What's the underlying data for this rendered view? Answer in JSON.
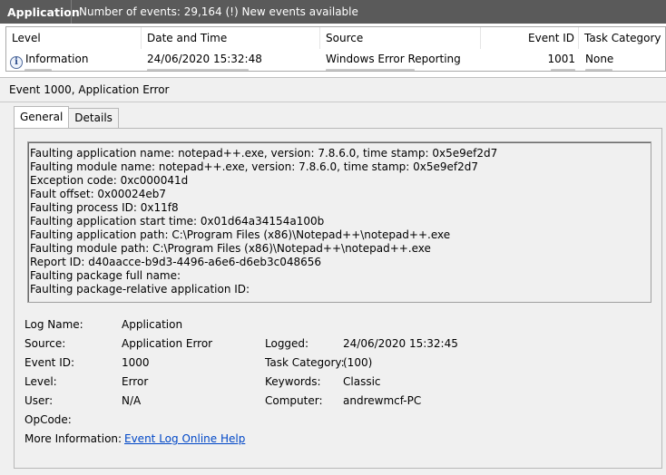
{
  "header": {
    "title": "Application",
    "info": "Number of events: 29,164 (!) New events available"
  },
  "events_table": {
    "columns": [
      "Level",
      "Date and Time",
      "Source",
      "Event ID",
      "Task Category"
    ],
    "rows": [
      {
        "level": "Information",
        "date_time": "24/06/2020 15:32:48",
        "source": "Windows Error Reporting",
        "event_id": "1001",
        "task_category": "None",
        "level_icon": "info-icon"
      }
    ]
  },
  "detail": {
    "title": "Event 1000, Application Error",
    "tabs": [
      "General",
      "Details"
    ],
    "active_tab": "General",
    "description_lines": [
      "Faulting application name: notepad++.exe, version: 7.8.6.0, time stamp: 0x5e9ef2d7",
      "Faulting module name: notepad++.exe, version: 7.8.6.0, time stamp: 0x5e9ef2d7",
      "Exception code: 0xc000041d",
      "Fault offset: 0x00024eb7",
      "Faulting process ID: 0x11f8",
      "Faulting application start time: 0x01d64a34154a100b",
      "Faulting application path: C:\\Program Files (x86)\\Notepad++\\notepad++.exe",
      "Faulting module path: C:\\Program Files (x86)\\Notepad++\\notepad++.exe",
      "Report ID: d40aacce-b9d3-4496-a6e6-d6eb3c048656",
      "Faulting package full name:",
      "Faulting package-relative application ID:"
    ],
    "properties": {
      "log_name_label": "Log Name:",
      "log_name": "Application",
      "source_label": "Source:",
      "source": "Application Error",
      "logged_label": "Logged:",
      "logged": "24/06/2020 15:32:45",
      "event_id_label": "Event ID:",
      "event_id": "1000",
      "task_category_label": "Task Category:",
      "task_category": "(100)",
      "level_label": "Level:",
      "level": "Error",
      "keywords_label": "Keywords:",
      "keywords": "Classic",
      "user_label": "User:",
      "user": "N/A",
      "computer_label": "Computer:",
      "computer": "andrewmcf-PC",
      "opcode_label": "OpCode:",
      "more_info_label": "More Information:",
      "more_info_link": "Event Log Online Help"
    }
  }
}
